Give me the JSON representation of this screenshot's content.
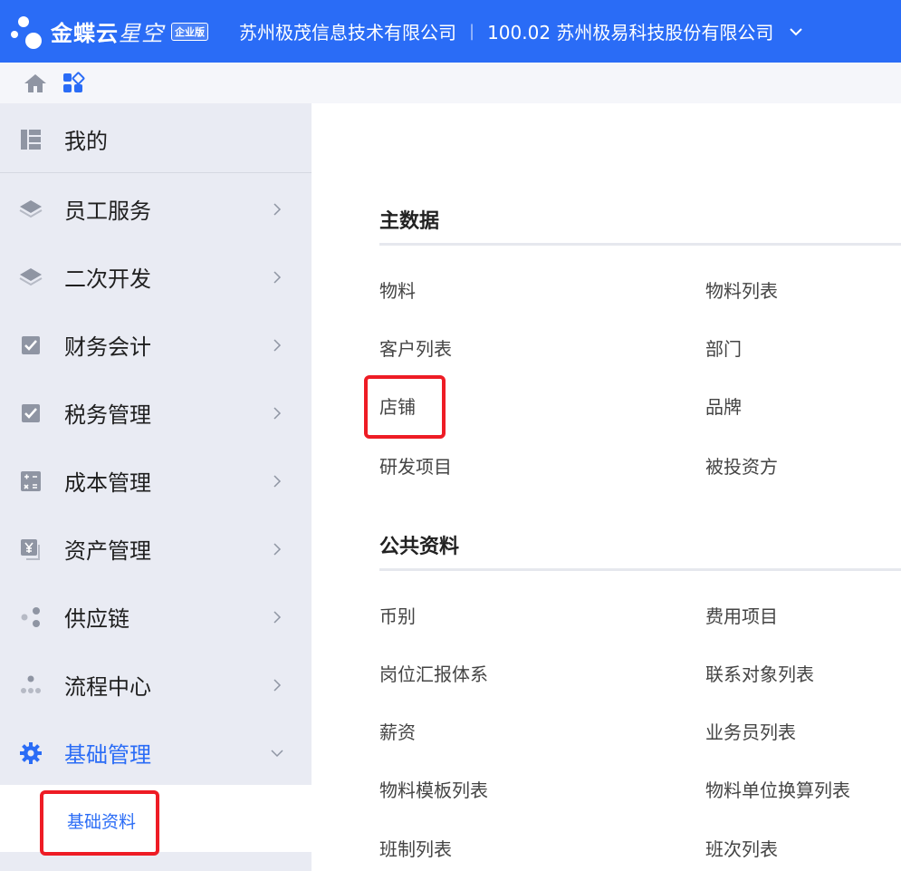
{
  "header": {
    "brand": "金蝶云",
    "brand_product": "星空",
    "edition": "企业版",
    "org": "苏州极茂信息技术有限公司",
    "separator": "|",
    "account": "100.02 苏州极易科技股份有限公司",
    "color": "#2a6cf6"
  },
  "toolbar": {
    "icons": [
      "home-icon",
      "apps-icon"
    ]
  },
  "sidebar": {
    "items": [
      {
        "label": "我的",
        "icon": "dashboard-icon"
      },
      {
        "label": "员工服务",
        "icon": "layers-icon"
      },
      {
        "label": "二次开发",
        "icon": "layers-icon"
      },
      {
        "label": "财务会计",
        "icon": "checkbox-icon"
      },
      {
        "label": "税务管理",
        "icon": "checkbox-icon"
      },
      {
        "label": "成本管理",
        "icon": "calculator-icon"
      },
      {
        "label": "资产管理",
        "icon": "yuan-icon"
      },
      {
        "label": "供应链",
        "icon": "nodes-icon"
      },
      {
        "label": "流程中心",
        "icon": "org-chart-icon"
      },
      {
        "label": "基础管理",
        "icon": "gear-icon"
      }
    ],
    "active_index": 9,
    "sub_item": "基础资料"
  },
  "main": {
    "sections": [
      {
        "title": "主数据",
        "links": [
          [
            "物料",
            "物料列表"
          ],
          [
            "客户列表",
            "部门"
          ],
          [
            "店铺",
            "品牌"
          ],
          [
            "研发项目",
            "被投资方"
          ]
        ]
      },
      {
        "title": "公共资料",
        "links": [
          [
            "币别",
            "费用项目"
          ],
          [
            "岗位汇报体系",
            "联系对象列表"
          ],
          [
            "薪资",
            "业务员列表"
          ],
          [
            "物料模板列表",
            "物料单位换算列表"
          ],
          [
            "班制列表",
            "班次列表"
          ]
        ]
      }
    ]
  },
  "colors": {
    "accent": "#2a6cf6",
    "highlight_box": "#ee1c25",
    "sidebar_bg": "#e9ebf3"
  }
}
